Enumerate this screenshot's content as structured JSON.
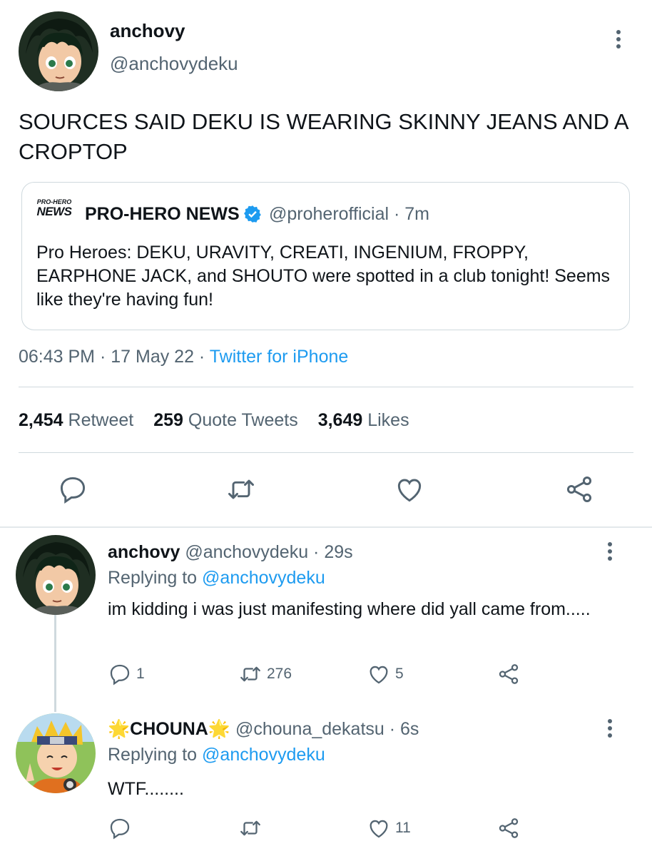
{
  "main_tweet": {
    "display_name": "anchovy",
    "handle": "@anchovydeku",
    "text": "SOURCES SAID DEKU IS WEARING SKINNY JEANS AND A CROPTOP",
    "quote": {
      "logo_text_top": "PRO-HERO",
      "logo_text_bottom": "NEWS",
      "display_name": "PRO-HERO NEWS",
      "handle_time": "@proherofficial · 7m",
      "text": "Pro Heroes: DEKU, URAVITY, CREATI, INGENIUM, FROPPY, EARPHONE JACK, and SHOUTO were spotted in a club tonight! Seems like they're having fun!"
    },
    "time": "06:43 PM",
    "date": "17 May 22",
    "source": "Twitter for iPhone",
    "stats": {
      "retweets": "2,454",
      "retweets_label": "Retweet",
      "quotes": "259",
      "quotes_label": "Quote Tweets",
      "likes": "3,649",
      "likes_label": "Likes"
    }
  },
  "replies": [
    {
      "display_name": "anchovy",
      "handle_time": "@anchovydeku · 29s",
      "replying_label": "Replying to",
      "replying_handle": "@anchovydeku",
      "text": "im kidding i was just manifesting where did yall came from.....",
      "reply_count": "1",
      "retweet_count": "276",
      "like_count": "5"
    },
    {
      "name_emoji": "🌟",
      "display_name": "CHOUNA",
      "handle_time": "@chouna_dekatsu · 6s",
      "replying_label": "Replying to",
      "replying_handle": "@anchovydeku",
      "text": "WTF........",
      "like_count": "11"
    }
  ],
  "colors": {
    "accent": "#1d9bf0",
    "secondary_text": "#536471",
    "border": "#cfd9de"
  },
  "icons": [
    "more-vertical-icon",
    "reply-icon",
    "retweet-icon",
    "like-icon",
    "share-icon",
    "verified-badge-icon"
  ]
}
